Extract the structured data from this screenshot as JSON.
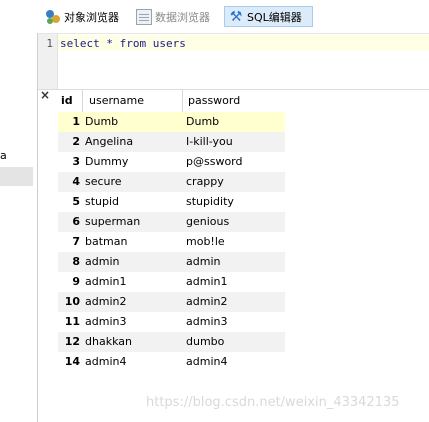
{
  "tabs": [
    {
      "label": "对象浏览器",
      "icon": "object-browser-icon"
    },
    {
      "label": "数据浏览器",
      "icon": "data-browser-icon"
    },
    {
      "label": "SQL编辑器",
      "icon": "sql-editor-icon"
    }
  ],
  "editor": {
    "line_number": "1",
    "code": "select * from users"
  },
  "left_panel": {
    "text": "a"
  },
  "results": {
    "close_label": "×",
    "columns": [
      "id",
      "username",
      "password"
    ],
    "rows": [
      {
        "id": "1",
        "username": "Dumb",
        "password": "Dumb"
      },
      {
        "id": "2",
        "username": "Angelina",
        "password": "I-kill-you"
      },
      {
        "id": "3",
        "username": "Dummy",
        "password": "p@ssword"
      },
      {
        "id": "4",
        "username": "secure",
        "password": "crappy"
      },
      {
        "id": "5",
        "username": "stupid",
        "password": "stupidity"
      },
      {
        "id": "6",
        "username": "superman",
        "password": "genious"
      },
      {
        "id": "7",
        "username": "batman",
        "password": "mob!le"
      },
      {
        "id": "8",
        "username": "admin",
        "password": "admin"
      },
      {
        "id": "9",
        "username": "admin1",
        "password": "admin1"
      },
      {
        "id": "10",
        "username": "admin2",
        "password": "admin2"
      },
      {
        "id": "11",
        "username": "admin3",
        "password": "admin3"
      },
      {
        "id": "12",
        "username": "dhakkan",
        "password": "dumbo"
      },
      {
        "id": "14",
        "username": "admin4",
        "password": "admin4"
      }
    ]
  },
  "watermark": "https://blog.csdn.net/weixin_43342135"
}
